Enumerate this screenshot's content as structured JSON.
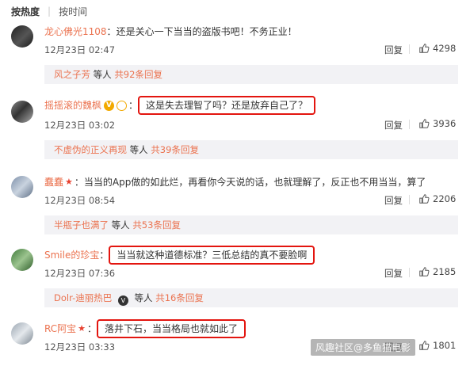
{
  "sort": {
    "hot": "按热度",
    "time": "按时间"
  },
  "reply_label": "回复",
  "colors": {
    "username": "#eb7350",
    "highlight": "#e3150f",
    "reply_bg": "#f2f2f5"
  },
  "comments": [
    {
      "user": "龙心佛光1108",
      "text": "还是关心一下当当的盗版书吧！不务正业！",
      "time": "12月23日 02:47",
      "likes": "4298",
      "reply_user": "风之子芳",
      "reply_mid": "等人",
      "reply_link": "共92条回复"
    },
    {
      "user": "摇摇滚的魏枫",
      "text": "这是失去理智了吗？还是放弃自己了？",
      "time": "12月23日 03:02",
      "likes": "3936",
      "reply_user": "不虚伪的正义再现",
      "reply_mid": "等人",
      "reply_link": "共39条回复"
    },
    {
      "user": "蠢蠢",
      "text": "当当的App做的如此烂，再看你今天说的话，也就理解了，反正也不用当当，算了",
      "time": "12月23日 08:54",
      "likes": "2206",
      "reply_user": "半瓶子也满了",
      "reply_mid": "等人",
      "reply_link": "共53条回复"
    },
    {
      "user": "Smile的珍宝",
      "text": "当当就这种道德标准？三低总结的真不要脸啊",
      "time": "12月23日 07:36",
      "likes": "2185",
      "reply_user": "Dolr-迪丽热巴",
      "reply_mid": "等人",
      "reply_link": "共16条回复"
    },
    {
      "user": "RC阿宝",
      "text": "落井下石，当当格局也就如此了",
      "time": "12月23日 03:33",
      "likes": "1801"
    }
  ],
  "watermark": "风趣社区@多鱼猫电影"
}
